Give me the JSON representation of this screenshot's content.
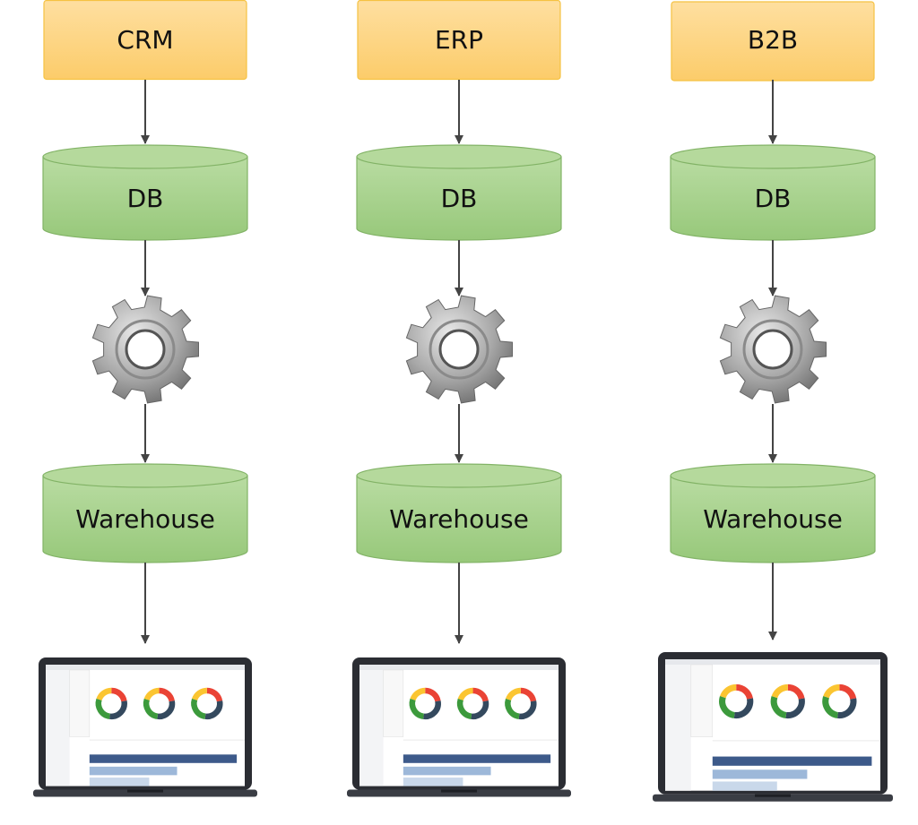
{
  "colors": {
    "source_fill": "#fdd68a",
    "source_stroke": "#f5c242",
    "db_fill": "#a9d18e",
    "db_stroke": "#82b366",
    "arrow": "#444444",
    "gear": "#9a9a9a"
  },
  "columns": [
    {
      "source": "CRM",
      "db": "DB",
      "warehouse": "Warehouse",
      "process_icon": "gear-icon",
      "output_icon": "laptop-dashboard-icon"
    },
    {
      "source": "ERP",
      "db": "DB",
      "warehouse": "Warehouse",
      "process_icon": "gear-icon",
      "output_icon": "laptop-dashboard-icon"
    },
    {
      "source": "B2B",
      "db": "DB",
      "warehouse": "Warehouse",
      "process_icon": "gear-icon",
      "output_icon": "laptop-dashboard-icon"
    }
  ]
}
